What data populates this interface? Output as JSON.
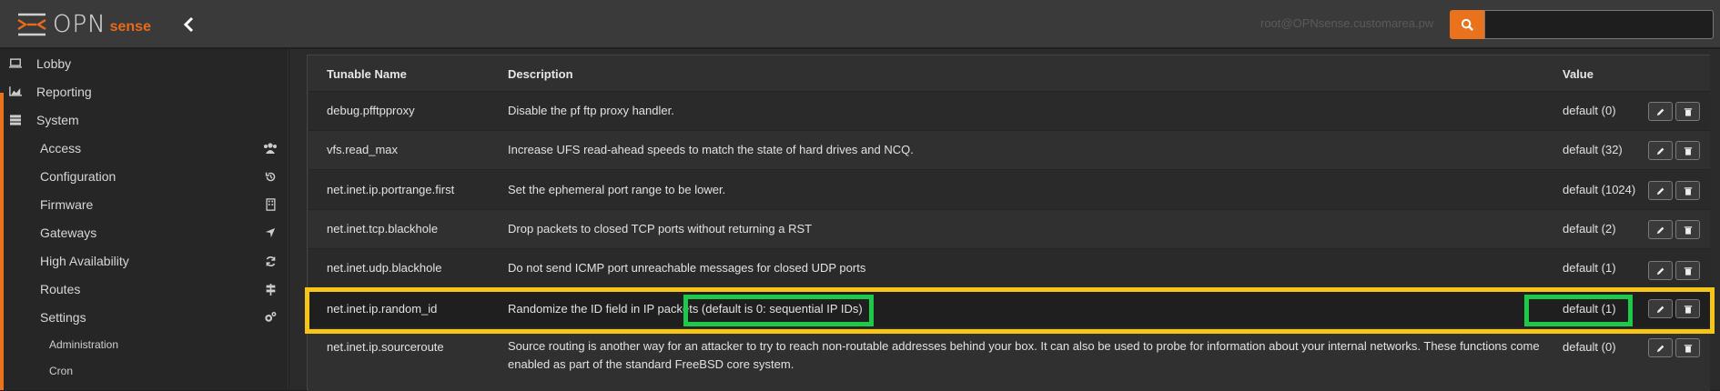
{
  "header": {
    "logo_opn": "OPN",
    "logo_sense": "sense",
    "user_label": "root@OPNsense.customarea.pw",
    "search_placeholder": "",
    "accent_color": "#e8731c"
  },
  "sidebar": {
    "items": [
      {
        "label": "Lobby",
        "icon": "laptop-icon"
      },
      {
        "label": "Reporting",
        "icon": "area-chart-icon"
      },
      {
        "label": "System",
        "icon": "server-icon"
      }
    ],
    "subitems": [
      {
        "label": "Access",
        "icon": "users-icon"
      },
      {
        "label": "Configuration",
        "icon": "history-icon"
      },
      {
        "label": "Firmware",
        "icon": "building-icon"
      },
      {
        "label": "Gateways",
        "icon": "location-arrow-icon"
      },
      {
        "label": "High Availability",
        "icon": "refresh-icon"
      },
      {
        "label": "Routes",
        "icon": "map-signs-icon"
      },
      {
        "label": "Settings",
        "icon": "cogs-icon"
      }
    ],
    "subsubitems": [
      {
        "label": "Administration"
      },
      {
        "label": "Cron"
      }
    ]
  },
  "table": {
    "headers": {
      "name": "Tunable Name",
      "description": "Description",
      "value": "Value"
    },
    "rows": [
      {
        "name": "debug.pfftpproxy",
        "description": "Disable the pf ftp proxy handler.",
        "value": "default (0)"
      },
      {
        "name": "vfs.read_max",
        "description": "Increase UFS read-ahead speeds to match the state of hard drives and NCQ.",
        "value": "default (32)"
      },
      {
        "name": "net.inet.ip.portrange.first",
        "description": "Set the ephemeral port range to be lower.",
        "value": "default (1024)"
      },
      {
        "name": "net.inet.tcp.blackhole",
        "description": "Drop packets to closed TCP ports without returning a RST",
        "value": "default (2)"
      },
      {
        "name": "net.inet.udp.blackhole",
        "description": "Do not send ICMP port unreachable messages for closed UDP ports",
        "value": "default (1)"
      },
      {
        "name": "net.inet.ip.random_id",
        "description": "Randomize the ID field in IP packets (default is 0: sequential IP IDs)",
        "value": "default (1)"
      },
      {
        "name": "net.inet.ip.sourceroute",
        "description": "Source routing is another way for an attacker to try to reach non-routable addresses behind your box. It can also be used to probe for information about your internal networks. These functions come enabled as part of the standard FreeBSD core system.",
        "value": "default (0)"
      }
    ]
  },
  "highlight_colors": {
    "row": "#f5c518",
    "cell": "#1ec94a"
  }
}
